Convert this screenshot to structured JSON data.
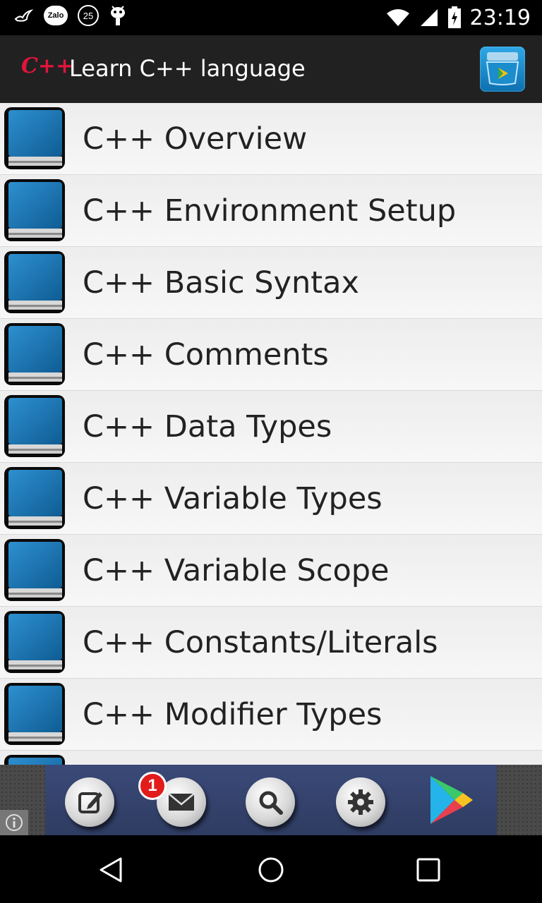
{
  "status_bar": {
    "zalo_label": "Zalo",
    "notification_count": "25",
    "time": "23:19"
  },
  "app_bar": {
    "logo": "C++",
    "title": "Learn C++ language",
    "store_icon": "store-icon"
  },
  "lessons": [
    {
      "label": "C++ Overview"
    },
    {
      "label": "C++ Environment Setup"
    },
    {
      "label": "C++ Basic Syntax"
    },
    {
      "label": "C++ Comments"
    },
    {
      "label": "C++ Data Types"
    },
    {
      "label": "C++ Variable Types"
    },
    {
      "label": "C++ Variable Scope"
    },
    {
      "label": "C++ Constants/Literals"
    },
    {
      "label": "C++ Modifier Types"
    },
    {
      "label": ""
    }
  ],
  "ad_bar": {
    "mail_badge": "1",
    "buttons": [
      "edit-icon",
      "mail-icon",
      "search-icon",
      "gear-icon",
      "play-store-icon"
    ]
  },
  "nav_bar": {
    "buttons": [
      "back-icon",
      "home-icon",
      "recents-icon"
    ]
  },
  "colors": {
    "accent": "#e1143c",
    "appbar": "#212121",
    "book": "#1a6fa8"
  }
}
